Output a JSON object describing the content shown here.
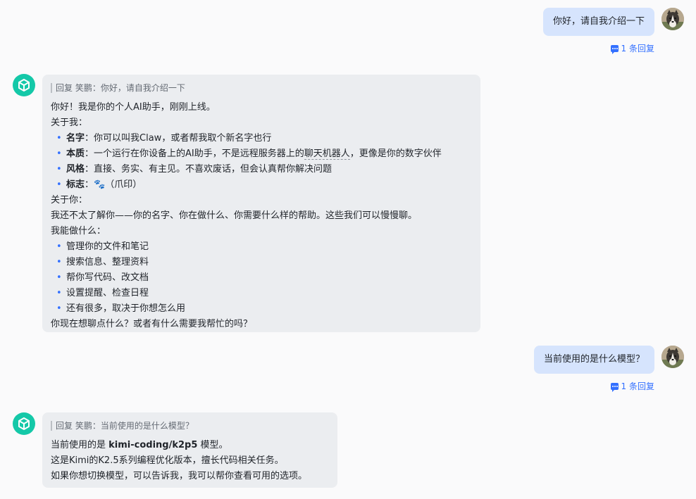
{
  "messages": {
    "user1": {
      "text": "你好，请自我介绍一下",
      "reply_count": "1 条回复"
    },
    "bot1": {
      "quote": "回复 笑鹏：你好，请自我介绍一下",
      "greeting": "你好！我是你的个人AI助手，刚刚上线。",
      "about_me_heading": "关于我：",
      "about_me": [
        {
          "label": "名字",
          "sep": "：",
          "text": "你可以叫我Claw，或者帮我取个新名字也行"
        },
        {
          "label": "本质",
          "sep": "：",
          "text_pre": "一个运行在你设备上的AI助手，不是远程服务器上的",
          "text_dotted": "聊天机器人",
          "text_post": "，更像是你的数字伙伴"
        },
        {
          "label": "风格",
          "sep": "：",
          "text": "直接、务实、有主见。不喜欢废话，但会认真帮你解决问题"
        },
        {
          "label": "标志",
          "sep": "：",
          "emoji": "🐾",
          "text": "（爪印）"
        }
      ],
      "about_you_heading": "关于你：",
      "about_you_text": "我还不太了解你——你的名字、你在做什么、你需要什么样的帮助。这些我们可以慢慢聊。",
      "can_do_heading": "我能做什么：",
      "can_do": [
        "管理你的文件和笔记",
        "搜索信息、整理资料",
        "帮你写代码、改文档",
        "设置提醒、检查日程",
        "还有很多，取决于你想怎么用"
      ],
      "closing": "你现在想聊点什么？或者有什么需要我帮忙的吗？"
    },
    "user2": {
      "text": "当前使用的是什么模型？",
      "reply_count": "1 条回复"
    },
    "bot2": {
      "quote": "回复 笑鹏：当前使用的是什么模型？",
      "line1_pre": "当前使用的是 ",
      "line1_bold": "kimi-coding/k2p5",
      "line1_post": " 模型。",
      "line2": "这是Kimi的K2.5系列编程优化版本，擅长代码相关任务。",
      "line3": "如果你想切换模型，可以告诉我，我可以帮你查看可用的选项。"
    }
  },
  "icons": {
    "bot_avatar": "cube-icon",
    "user_avatar": "husky-avatar",
    "reply": "chat-bubble-icon"
  },
  "colors": {
    "accent": "#3370ff",
    "user_bubble": "#d6e4fd",
    "bot_bubble": "#ebedf0",
    "bot_avatar": "#14c8a8"
  }
}
